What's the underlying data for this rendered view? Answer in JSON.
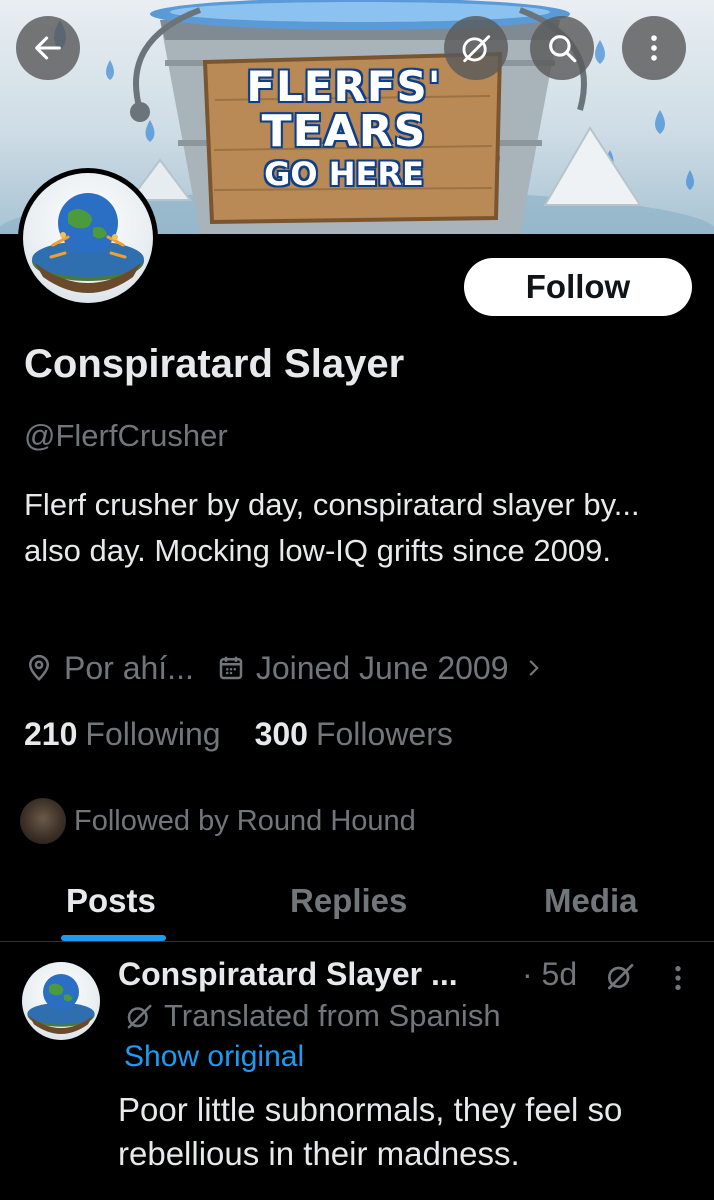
{
  "banner": {
    "sign_line1": "FLERFS'",
    "sign_line2": "TEARS",
    "sign_line3": "GO HERE"
  },
  "header_buttons": {
    "back_icon": "arrow-left-icon",
    "grok_icon": "grok-icon",
    "search_icon": "search-icon",
    "more_icon": "more-vertical-icon"
  },
  "profile": {
    "follow_label": "Follow",
    "name": "Conspiratard Slayer",
    "handle": "@FlerfCrusher",
    "bio": "Flerf crusher by day, conspiratard slayer by... also day. Mocking low-IQ grifts since 2009.",
    "location": "Por ahí...",
    "joined": "Joined June 2009",
    "following_count": "210",
    "following_label": "Following",
    "followers_count": "300",
    "followers_label": "Followers",
    "followed_by": "Followed by Round Hound"
  },
  "tabs": [
    {
      "label": "Posts",
      "active": true
    },
    {
      "label": "Replies",
      "active": false
    },
    {
      "label": "Media",
      "active": false
    }
  ],
  "post": {
    "author": "Conspiratard Slayer ...",
    "time": "· 5d",
    "translated": "Translated from Spanish",
    "show_original": "Show original",
    "text": "Poor little subnormals, they feel so rebellious in their madness."
  },
  "colors": {
    "accent": "#1d9bf0",
    "muted": "#71767b",
    "text": "#e7e9ea",
    "background": "#000000"
  }
}
